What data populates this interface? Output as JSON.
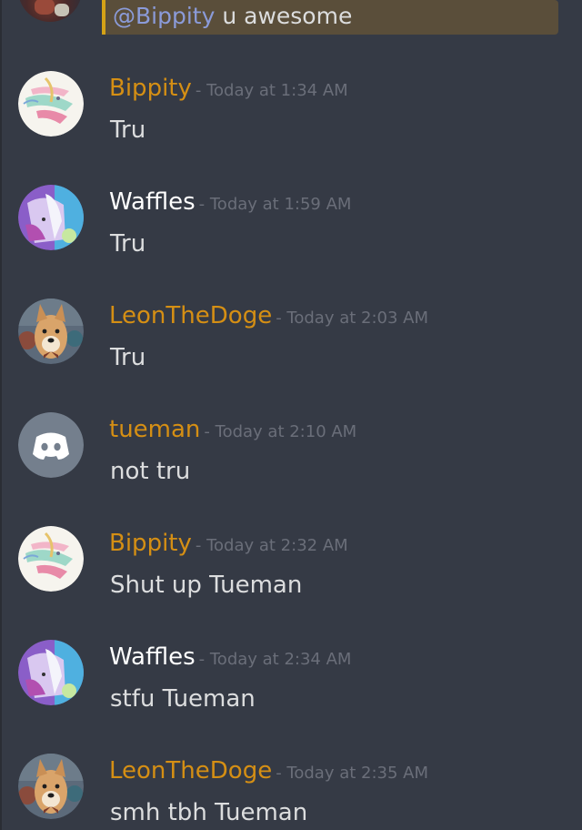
{
  "colors": {
    "background": "#353a45",
    "text": "#dcddde",
    "timestamp": "#6a6e79",
    "mention": "#8b9bd9",
    "mention_bar": "#d4a217",
    "mention_bg": "#5a4e3a"
  },
  "top_message": {
    "mention": "@Bippity",
    "text": " u awesome"
  },
  "messages": [
    {
      "username": "Bippity",
      "color": "#d58f14",
      "timestamp": "- Today at 1:34 AM",
      "text": "Tru",
      "avatar": "anime-avatar-bippity"
    },
    {
      "username": "Waffles",
      "color": "#ffffff",
      "timestamp": "- Today at 1:59 AM",
      "text": "Tru",
      "avatar": "anime-avatar-waffles"
    },
    {
      "username": "LeonTheDoge",
      "color": "#d58f14",
      "timestamp": "- Today at 2:03 AM",
      "text": "Tru",
      "avatar": "doge-avatar"
    },
    {
      "username": "tueman",
      "color": "#d58f14",
      "timestamp": "- Today at 2:10 AM",
      "text": "not tru",
      "avatar": "discord-default-avatar"
    },
    {
      "username": "Bippity",
      "color": "#d58f14",
      "timestamp": "- Today at 2:32 AM",
      "text": "Shut up Tueman",
      "avatar": "anime-avatar-bippity"
    },
    {
      "username": "Waffles",
      "color": "#ffffff",
      "timestamp": "- Today at 2:34 AM",
      "text": "stfu Tueman",
      "avatar": "anime-avatar-waffles"
    },
    {
      "username": "LeonTheDoge",
      "color": "#d58f14",
      "timestamp": "- Today at 2:35 AM",
      "text": "smh tbh Tueman",
      "avatar": "doge-avatar"
    }
  ]
}
